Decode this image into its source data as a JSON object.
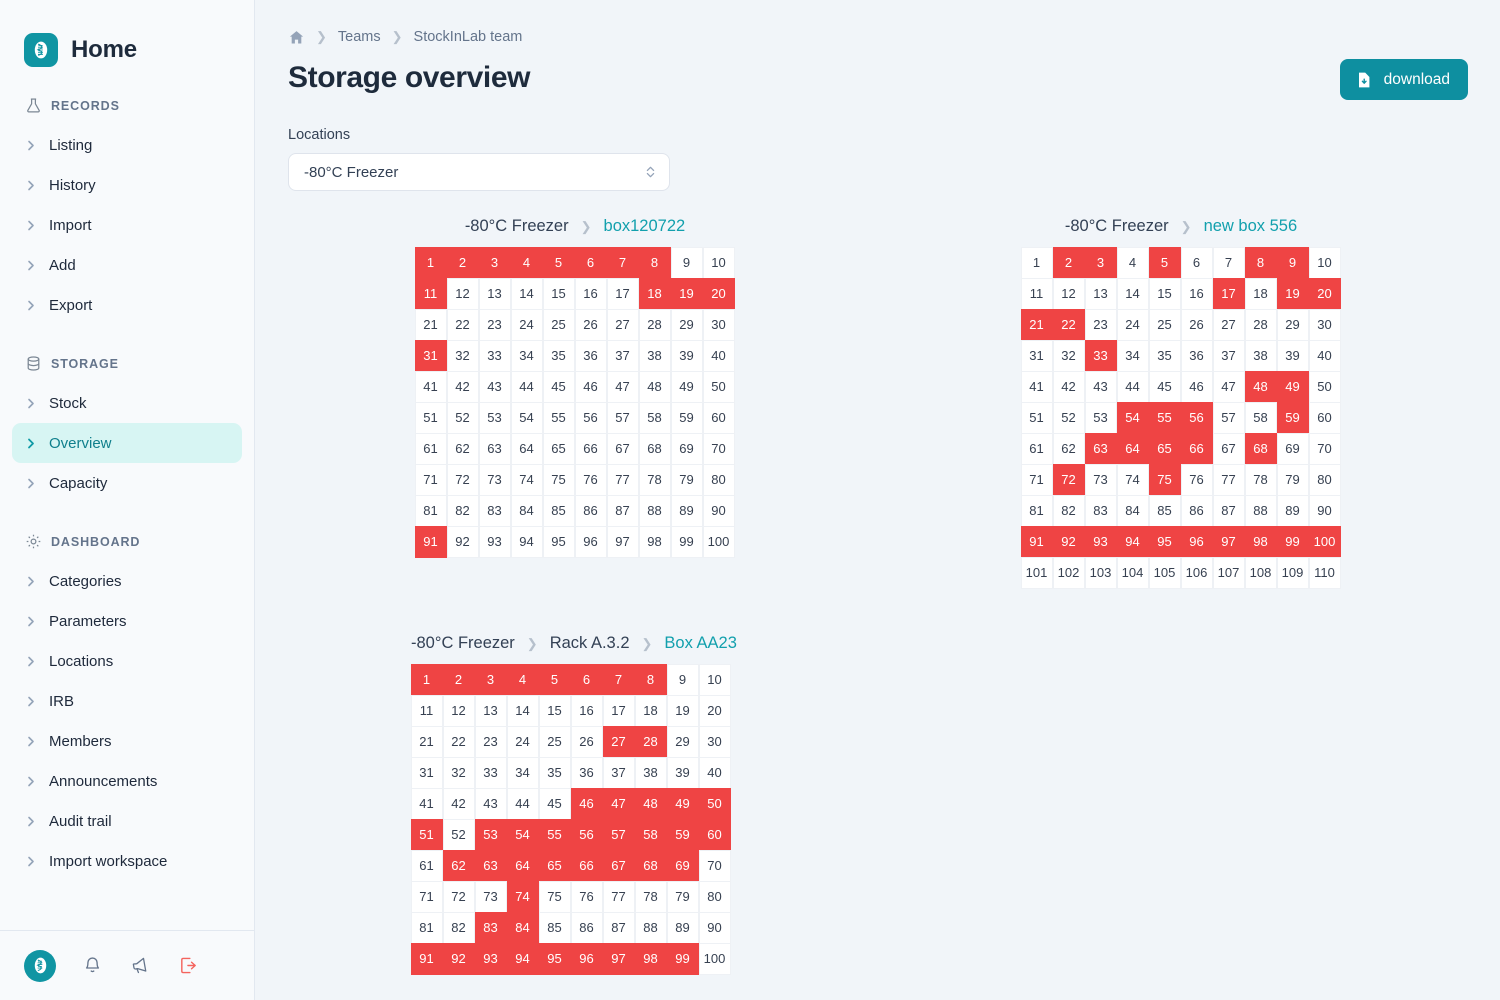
{
  "brand": {
    "title": "Home",
    "logo_icon": "dna-logo-icon"
  },
  "sidebar": {
    "sections": [
      {
        "label": "RECORDS",
        "icon": "flask-icon",
        "items": [
          {
            "label": "Listing",
            "active": false
          },
          {
            "label": "History",
            "active": false
          },
          {
            "label": "Import",
            "active": false
          },
          {
            "label": "Add",
            "active": false
          },
          {
            "label": "Export",
            "active": false
          }
        ]
      },
      {
        "label": "STORAGE",
        "icon": "database-icon",
        "items": [
          {
            "label": "Stock",
            "active": false
          },
          {
            "label": "Overview",
            "active": true
          },
          {
            "label": "Capacity",
            "active": false
          }
        ]
      },
      {
        "label": "DASHBOARD",
        "icon": "gear-icon",
        "items": [
          {
            "label": "Categories",
            "active": false
          },
          {
            "label": "Parameters",
            "active": false
          },
          {
            "label": "Locations",
            "active": false
          },
          {
            "label": "IRB",
            "active": false
          },
          {
            "label": "Members",
            "active": false
          },
          {
            "label": "Announcements",
            "active": false
          },
          {
            "label": "Audit trail",
            "active": false
          },
          {
            "label": "Import workspace",
            "active": false
          }
        ]
      }
    ],
    "footer_icons": [
      {
        "name": "account-logo-icon"
      },
      {
        "name": "bell-icon"
      },
      {
        "name": "megaphone-icon"
      },
      {
        "name": "logout-icon"
      }
    ]
  },
  "header": {
    "breadcrumb": [
      {
        "label": "home-icon",
        "is_icon": true
      },
      {
        "label": "Teams",
        "is_icon": false
      },
      {
        "label": "StockInLab team",
        "is_icon": false
      }
    ],
    "title": "Storage overview",
    "download_label": "download",
    "download_icon": "file-download-icon"
  },
  "filter": {
    "label": "Locations",
    "value": "-80°C Freezer",
    "placeholder": "-80°C Freezer",
    "options": [
      "-80°C Freezer"
    ],
    "caret_icon": "chevron-updown-icon"
  },
  "colors": {
    "accent_teal": "#0e8fa0",
    "link_teal": "#12a0ad",
    "filled_cell": "#ef4444",
    "empty_cell": "#ffffff",
    "active_nav_bg": "#d7f5f3",
    "page_bg": "#f1f5f9",
    "logout_red": "#f4645e"
  },
  "boards": [
    {
      "id": "b1",
      "crumbs": [
        "-80°C Freezer",
        "box120722"
      ],
      "rows": 10,
      "cols": 10,
      "total": 100,
      "filled": [
        1,
        2,
        3,
        4,
        5,
        6,
        7,
        8,
        11,
        18,
        19,
        20,
        31,
        91
      ]
    },
    {
      "id": "b2",
      "crumbs": [
        "-80°C Freezer",
        "new box 556"
      ],
      "rows": 11,
      "cols": 10,
      "total": 110,
      "filled": [
        2,
        3,
        5,
        8,
        9,
        17,
        19,
        20,
        21,
        22,
        33,
        48,
        49,
        54,
        55,
        56,
        59,
        63,
        64,
        65,
        66,
        68,
        72,
        75,
        91,
        92,
        93,
        94,
        95,
        96,
        97,
        98,
        99,
        100
      ]
    },
    {
      "id": "b3",
      "crumbs": [
        "-80°C Freezer",
        "Rack A.3.2",
        "Box AA23"
      ],
      "rows": 10,
      "cols": 10,
      "total": 100,
      "filled": [
        1,
        2,
        3,
        4,
        5,
        6,
        7,
        8,
        27,
        28,
        46,
        47,
        48,
        49,
        50,
        51,
        53,
        54,
        55,
        56,
        57,
        58,
        59,
        60,
        62,
        63,
        64,
        65,
        66,
        67,
        68,
        69,
        74,
        83,
        84,
        91,
        92,
        93,
        94,
        95,
        96,
        97,
        98,
        99
      ]
    }
  ]
}
